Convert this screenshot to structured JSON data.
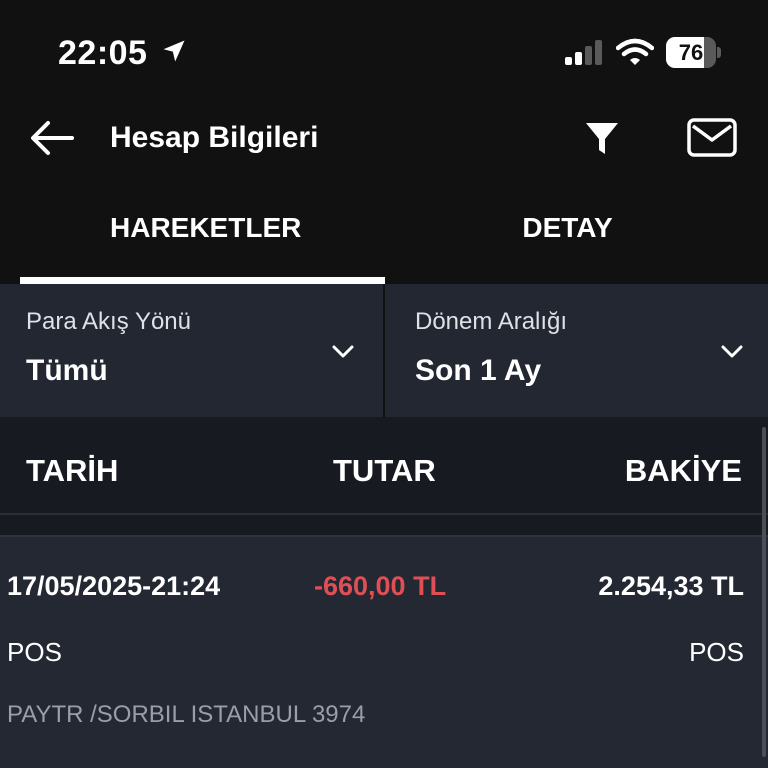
{
  "status_bar": {
    "time": "22:05",
    "battery_level": "76",
    "battery_fraction": 0.76
  },
  "header": {
    "title": "Hesap Bilgileri",
    "icons": {
      "back": "arrow-left-icon",
      "filter": "filter-icon",
      "mail": "envelope-icon"
    }
  },
  "tabs": [
    {
      "label": "HAREKETLER",
      "active": true
    },
    {
      "label": "DETAY",
      "active": false
    }
  ],
  "filters": {
    "direction": {
      "label": "Para Akış Yönü",
      "value": "Tümü"
    },
    "period": {
      "label": "Dönem Aralığı",
      "value": "Son 1 Ay"
    }
  },
  "table": {
    "columns": [
      "TARİH",
      "TUTAR",
      "BAKİYE"
    ],
    "rows": [
      {
        "date": "17/05/2025-21:24",
        "amount": "-660,00 TL",
        "balance": "2.254,33 TL",
        "type": "POS",
        "channel": "POS",
        "description": "PAYTR /SORBIL ISTANBUL 3974"
      }
    ]
  },
  "colors": {
    "background": "#111111",
    "panel": "#222731",
    "negative_amount": "#e04f55",
    "active_tab": "#ffffff"
  }
}
